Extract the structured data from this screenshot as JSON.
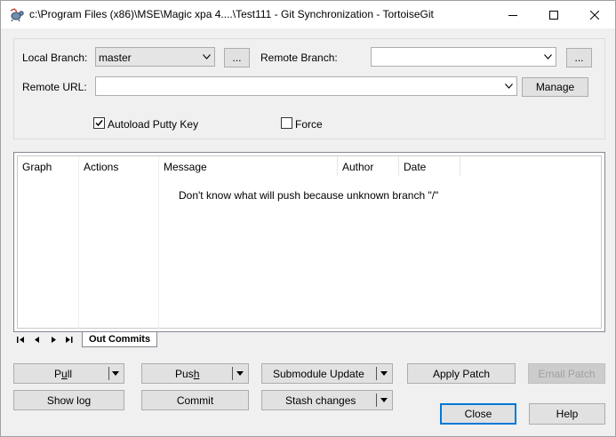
{
  "window": {
    "title": "c:\\Program Files (x86)\\MSE\\Magic xpa 4....\\Test111 - Git Synchronization - TortoiseGit"
  },
  "form": {
    "local_branch_label": "Local Branch:",
    "local_branch_value": "master",
    "local_browse_label": "...",
    "remote_branch_label": "Remote Branch:",
    "remote_branch_value": "",
    "remote_browse_label": "...",
    "remote_url_label": "Remote URL:",
    "remote_url_value": "",
    "manage_label": "Manage",
    "autoload_label": "Autoload Putty Key",
    "autoload_checked": true,
    "force_label": "Force",
    "force_checked": false
  },
  "list": {
    "columns": [
      "Graph",
      "Actions",
      "Message",
      "Author",
      "Date"
    ],
    "message": "Don't know what will push because unknown branch \"/\""
  },
  "tabs": {
    "active": "Out Commits"
  },
  "buttons": {
    "pull_pre": "P",
    "pull_u": "u",
    "pull_post": "ll",
    "push_pre": "Pus",
    "push_u": "h",
    "push_post": "",
    "submodule_update": "Submodule Update",
    "apply_patch": "Apply Patch",
    "email_patch": "Email Patch",
    "show_log": "Show log",
    "commit": "Commit",
    "stash_changes": "Stash changes",
    "close": "Close",
    "help": "Help"
  }
}
